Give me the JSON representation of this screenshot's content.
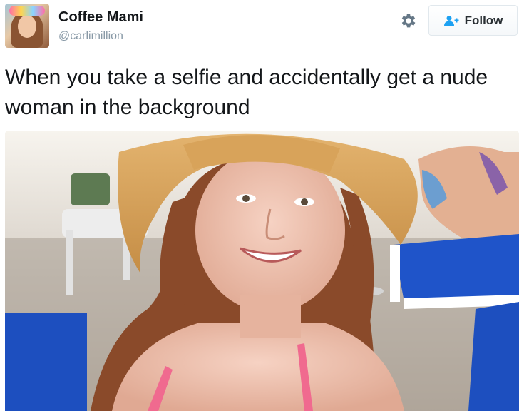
{
  "user": {
    "display_name": "Coffee Mami",
    "handle": "@carlimillion"
  },
  "actions": {
    "settings_icon": "gear-icon",
    "follow_icon": "follow-person-plus-icon",
    "follow_label": "Follow"
  },
  "tweet": {
    "text": "When you take a selfie and accidentally get a nude woman in the background"
  },
  "colors": {
    "name": "#14171a",
    "handle": "#8899a6",
    "follow_border": "#e1e8ed",
    "follow_icon": "#1da1f2",
    "lounger_blue": "#1f54c9"
  }
}
